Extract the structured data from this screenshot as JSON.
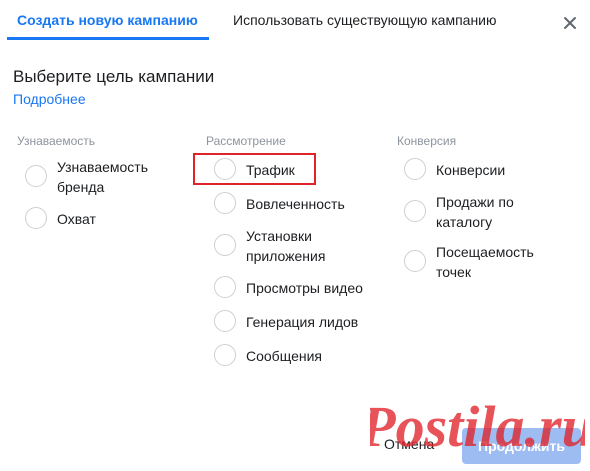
{
  "tabs": {
    "create": "Создать новую кампанию",
    "existing": "Использовать существующую кампанию",
    "active": "create"
  },
  "close_icon": "close-icon",
  "heading": "Выберите цель кампании",
  "learn_more": "Подробнее",
  "columns": {
    "awareness": {
      "title": "Узнаваемость",
      "options": [
        "Узнаваемость бренда",
        "Охват"
      ]
    },
    "consideration": {
      "title": "Рассмотрение",
      "options": [
        "Трафик",
        "Вовлеченность",
        "Установки приложения",
        "Просмотры видео",
        "Генерация лидов",
        "Сообщения"
      ]
    },
    "conversion": {
      "title": "Конверсия",
      "options": [
        "Конверсии",
        "Продажи по каталогу",
        "Посещаемость точек"
      ]
    }
  },
  "highlighted_option": "Трафик",
  "footer": {
    "cancel": "Отмена",
    "continue": "Продолжить"
  },
  "watermark": {
    "text": "Postila.ru",
    "color": "#e0232a"
  },
  "colors": {
    "accent": "#1877f2",
    "highlight_border": "#e0232a",
    "muted": "#8d949e",
    "button_disabled": "#9cbcf2"
  }
}
